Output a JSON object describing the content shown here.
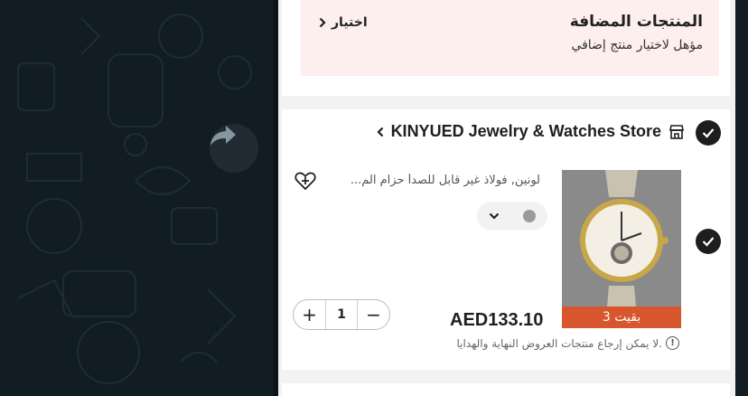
{
  "chat": {
    "forward_icon": "forward-share-icon"
  },
  "promo": {
    "title": "المنتجات المضافة",
    "subtitle": "مؤهل لاختيار منتج إضافي",
    "choose_label": "اختيار"
  },
  "store": {
    "name": "KINYUED Jewelry & Watches Store",
    "icon": "store-icon"
  },
  "product": {
    "title": "لونين, فولاذ غير قابل للصدأ حزام الم...",
    "price": "AED133.10",
    "stock_label": "بقيت 3",
    "quantity": "1",
    "minus_label": "−",
    "plus_label": "+",
    "notice": ".لا يمكن إرجاع منتجات العروض النهاية والهدايا"
  },
  "colors": {
    "accent": "#d8562e",
    "promo_bg": "#fcefed",
    "check": "#1e1e1e"
  }
}
